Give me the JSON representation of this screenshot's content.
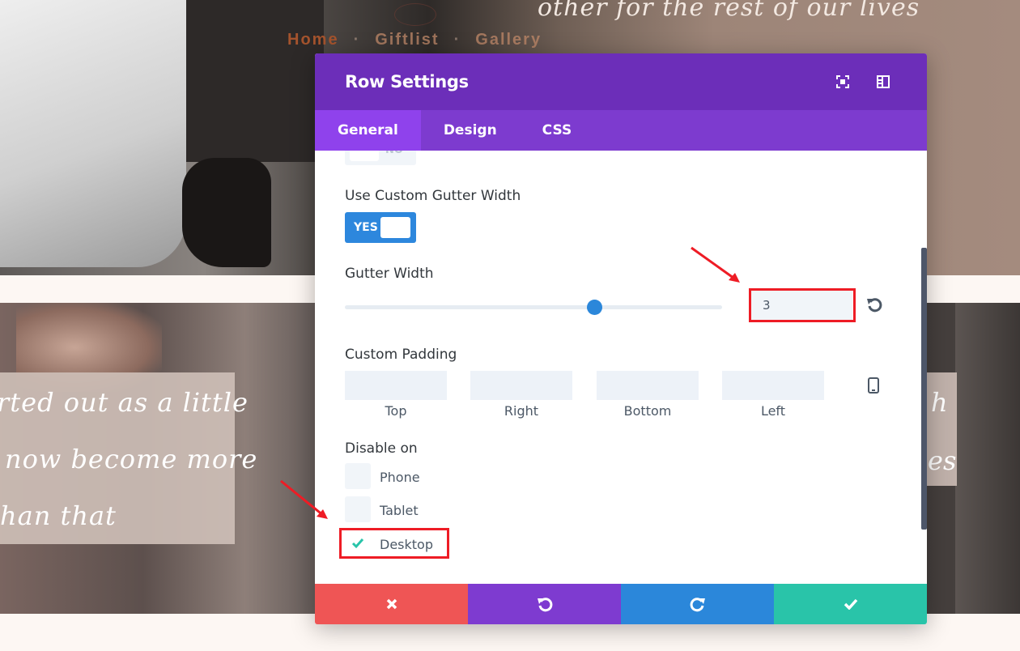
{
  "background": {
    "script_top": "other for the rest of our lives",
    "nav": [
      "Home",
      "Giftlist",
      "Gallery"
    ],
    "quote_lines": [
      "rted out as a little",
      "now become more",
      "han that"
    ],
    "quote_right_lines": [
      "h",
      "es"
    ]
  },
  "modal": {
    "title": "Row Settings",
    "tabs": [
      "General",
      "Design",
      "CSS"
    ],
    "active_tab": "General",
    "top_toggle_label": "NO",
    "custom_gutter": {
      "label": "Use Custom Gutter Width",
      "toggle_text": "YES"
    },
    "gutter_width": {
      "label": "Gutter Width",
      "value": "3",
      "slider_fraction": 0.66
    },
    "custom_padding": {
      "label": "Custom Padding",
      "fields": [
        "Top",
        "Right",
        "Bottom",
        "Left"
      ]
    },
    "disable_on": {
      "label": "Disable on",
      "options": [
        {
          "label": "Phone",
          "checked": false
        },
        {
          "label": "Tablet",
          "checked": false
        },
        {
          "label": "Desktop",
          "checked": true
        }
      ]
    }
  },
  "colors": {
    "header": "#6c2eb9",
    "tabs": "#7d3bcf",
    "active_tab": "#8f42ec",
    "cancel": "#ef5555",
    "undo": "#7e3bd0",
    "redo": "#2b87da",
    "save": "#29c4a9",
    "annotation": "#ee1c25"
  },
  "icons": {
    "header": [
      "fullscreen-icon",
      "sidebar-layout-icon"
    ],
    "footer": [
      "close-icon",
      "undo-icon",
      "redo-icon",
      "checkmark-icon"
    ]
  }
}
